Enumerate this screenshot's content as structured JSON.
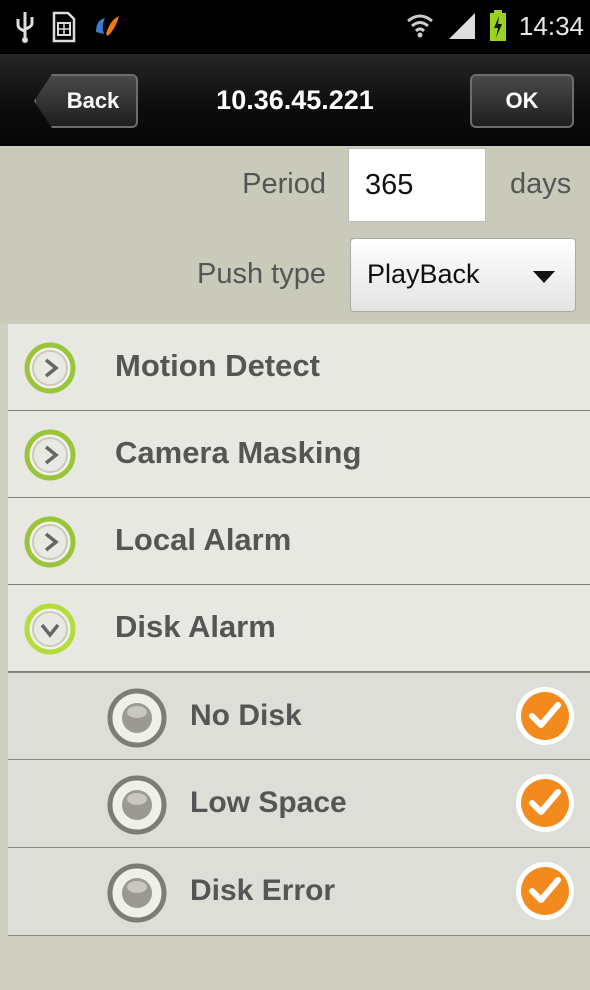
{
  "status_bar": {
    "time": "14:34",
    "left_icons": [
      "usb-icon",
      "sim-card-icon",
      "app-notification-icon"
    ],
    "right_icons": [
      "wifi-icon",
      "signal-icon",
      "battery-charging-icon"
    ]
  },
  "header": {
    "back_label": "Back",
    "title": "10.36.45.221",
    "ok_label": "OK"
  },
  "settings": {
    "period_label": "Period",
    "period_value": "365",
    "period_unit": "days",
    "push_type_label": "Push type",
    "push_type_value": "PlayBack"
  },
  "categories": [
    {
      "label": "Motion Detect",
      "expanded": false
    },
    {
      "label": "Camera Masking",
      "expanded": false
    },
    {
      "label": "Local Alarm",
      "expanded": false
    },
    {
      "label": "Disk Alarm",
      "expanded": true
    }
  ],
  "disk_alarm_items": [
    {
      "label": "No Disk",
      "checked": true
    },
    {
      "label": "Low Space",
      "checked": true
    },
    {
      "label": "Disk Error",
      "checked": true
    }
  ],
  "colors": {
    "accent_green": "#9ac43a",
    "check_orange": "#f28a1e",
    "background": "#cfcfbf"
  }
}
